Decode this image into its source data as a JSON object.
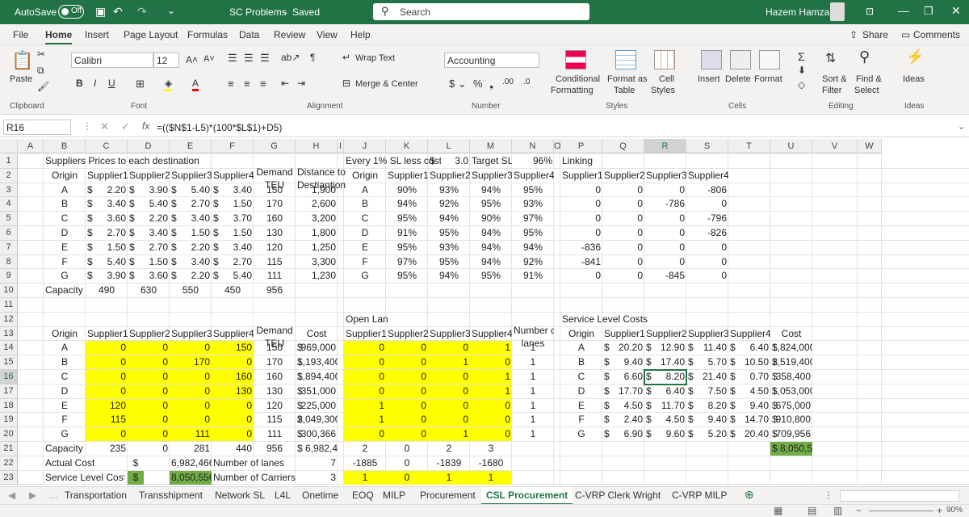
{
  "titlebar": {
    "autosave": "AutoSave",
    "autosave_state": "Off",
    "file_title": "SC Problems",
    "saved_state": "Saved",
    "search_placeholder": "Search",
    "user": "Hazem Hamza"
  },
  "menu": [
    "File",
    "Home",
    "Insert",
    "Page Layout",
    "Formulas",
    "Data",
    "Review",
    "View",
    "Help"
  ],
  "share": "Share",
  "comments": "Comments",
  "ribbon": {
    "font_name": "Calibri",
    "font_size": "12",
    "number_format": "Accounting",
    "wrap_text": "Wrap Text",
    "merge_center": "Merge & Center",
    "paste": "Paste",
    "cond_fmt": "Conditional",
    "cond_fmt2": "Formatting",
    "fmt_table": "Format as",
    "fmt_table2": "Table",
    "cell_styles": "Cell",
    "cell_styles2": "Styles",
    "insert": "Insert",
    "delete": "Delete",
    "format": "Format",
    "sort": "Sort &",
    "sort2": "Filter",
    "find": "Find &",
    "find2": "Select",
    "ideas": "Ideas",
    "groups": [
      "Clipboard",
      "Font",
      "Alignment",
      "Number",
      "Styles",
      "Cells",
      "Editing",
      "Ideas"
    ]
  },
  "formula": {
    "namebox": "R16",
    "fx": "fx",
    "content": "=(($N$1-L5)*(100*$L$1)+D5)"
  },
  "columns": [
    "A",
    "B",
    "C",
    "D",
    "E",
    "F",
    "G",
    "H",
    "I",
    "J",
    "K",
    "L",
    "M",
    "N",
    "O",
    "P",
    "Q",
    "R",
    "S",
    "T",
    "U",
    "V",
    "W"
  ],
  "rows": [
    "1",
    "2",
    "3",
    "4",
    "5",
    "6",
    "7",
    "8",
    "9",
    "10",
    "11",
    "12",
    "13",
    "14",
    "15",
    "16",
    "17",
    "18",
    "19",
    "20",
    "21",
    "22",
    "23"
  ],
  "cells": {
    "r1": {
      "B": "Suppliers Prices to each destination",
      "J": "Every 1% SL less cost",
      "K": "$",
      "L": "3.0",
      "M": "Target SL",
      "N": "96%",
      "P": "Linking"
    },
    "r2": {
      "B": "Origin",
      "C": "Supplier1",
      "D": "Supplier2",
      "E": "Supplier3",
      "F": "Supplier4",
      "G1": "Demand",
      "G": "TEU",
      "H1": "Distance to",
      "H": "Destiantion Z",
      "J": "Origin",
      "K": "Supplier1",
      "L": "Supplier2",
      "M": "Supplier3",
      "N": "Supplier4",
      "P": "Supplier1",
      "Q": "Supplier2",
      "R": "Supplier3",
      "S": "Supplier4"
    },
    "prices": [
      {
        "o": "A",
        "v": [
          "2.20",
          "3.90",
          "5.40",
          "3.40"
        ],
        "d": "150",
        "z": "1,900",
        "sl": [
          "90%",
          "93%",
          "94%",
          "95%"
        ],
        "lk": [
          "0",
          "0",
          "0",
          "-806"
        ]
      },
      {
        "o": "B",
        "v": [
          "3.40",
          "5.40",
          "2.70",
          "1.50"
        ],
        "d": "170",
        "z": "2,600",
        "sl": [
          "94%",
          "92%",
          "95%",
          "93%"
        ],
        "lk": [
          "0",
          "0",
          "-786",
          "0"
        ]
      },
      {
        "o": "C",
        "v": [
          "3.60",
          "2.20",
          "3.40",
          "3.70"
        ],
        "d": "160",
        "z": "3,200",
        "sl": [
          "95%",
          "94%",
          "90%",
          "97%"
        ],
        "lk": [
          "0",
          "0",
          "0",
          "-796"
        ]
      },
      {
        "o": "D",
        "v": [
          "2.70",
          "3.40",
          "1.50",
          "1.50"
        ],
        "d": "130",
        "z": "1,800",
        "sl": [
          "91%",
          "95%",
          "94%",
          "95%"
        ],
        "lk": [
          "0",
          "0",
          "0",
          "-826"
        ]
      },
      {
        "o": "E",
        "v": [
          "1.50",
          "2.70",
          "2.20",
          "3.40"
        ],
        "d": "120",
        "z": "1,250",
        "sl": [
          "95%",
          "93%",
          "94%",
          "94%"
        ],
        "lk": [
          "-836",
          "0",
          "0",
          "0"
        ]
      },
      {
        "o": "F",
        "v": [
          "5.40",
          "1.50",
          "3.40",
          "2.70"
        ],
        "d": "115",
        "z": "3,300",
        "sl": [
          "97%",
          "95%",
          "94%",
          "92%"
        ],
        "lk": [
          "-841",
          "0",
          "0",
          "0"
        ]
      },
      {
        "o": "G",
        "v": [
          "3.90",
          "3.60",
          "2.20",
          "5.40"
        ],
        "d": "111",
        "z": "1,230",
        "sl": [
          "95%",
          "94%",
          "95%",
          "91%"
        ],
        "lk": [
          "0",
          "0",
          "-845",
          "0"
        ]
      }
    ],
    "r10": {
      "B": "Capacity",
      "C": "490",
      "D": "630",
      "E": "550",
      "F": "450",
      "G": "956"
    },
    "r12": {
      "J": "Open Lan",
      "P": "Service Level Costs"
    },
    "r13": {
      "B": "Origin",
      "C": "Supplier1",
      "D": "Supplier2",
      "E": "Supplier3",
      "F": "Supplier4",
      "G1": "Demand",
      "G": "TEU",
      "H": "Cost",
      "J": "Supplier1",
      "K": "Supplier2",
      "L": "Supplier3",
      "M": "Supplier4",
      "N1": "Number of",
      "N": "lanes",
      "P": "Origin",
      "Q": "Supplier1",
      "R": "Supplier2",
      "S": "Supplier3",
      "T": "Supplier4",
      "U": "Cost"
    },
    "alloc": [
      {
        "o": "A",
        "q": [
          "0",
          "0",
          "0",
          "150"
        ],
        "d": "150",
        "cost": "969,000",
        "ol": [
          "0",
          "0",
          "0",
          "1"
        ],
        "n": "1",
        "sc": [
          "20.20",
          "12.90",
          "11.40",
          "6.40"
        ],
        "u": "1,824,000"
      },
      {
        "o": "B",
        "q": [
          "0",
          "0",
          "170",
          "0"
        ],
        "d": "170",
        "cost": "1,193,400",
        "ol": [
          "0",
          "0",
          "1",
          "0"
        ],
        "n": "1",
        "sc": [
          "9.40",
          "17.40",
          "5.70",
          "10.50"
        ],
        "u": "2,519,400"
      },
      {
        "o": "C",
        "q": [
          "0",
          "0",
          "0",
          "160"
        ],
        "d": "160",
        "cost": "1,894,400",
        "ol": [
          "0",
          "0",
          "0",
          "1"
        ],
        "n": "1",
        "sc": [
          "6.60",
          "8.20",
          "21.40",
          "0.70"
        ],
        "u": "358,400"
      },
      {
        "o": "D",
        "q": [
          "0",
          "0",
          "0",
          "130"
        ],
        "d": "130",
        "cost": "351,000",
        "ol": [
          "0",
          "0",
          "0",
          "1"
        ],
        "n": "1",
        "sc": [
          "17.70",
          "6.40",
          "7.50",
          "4.50"
        ],
        "u": "1,053,000"
      },
      {
        "o": "E",
        "q": [
          "120",
          "0",
          "0",
          "0"
        ],
        "d": "120",
        "cost": "225,000",
        "ol": [
          "1",
          "0",
          "0",
          "0"
        ],
        "n": "1",
        "sc": [
          "4.50",
          "11.70",
          "8.20",
          "9.40"
        ],
        "u": "675,000"
      },
      {
        "o": "F",
        "q": [
          "115",
          "0",
          "0",
          "0"
        ],
        "d": "115",
        "cost": "2,049,300",
        "ol": [
          "1",
          "0",
          "0",
          "0"
        ],
        "n": "1",
        "sc": [
          "2.40",
          "4.50",
          "9.40",
          "14.70"
        ],
        "u": "910,800"
      },
      {
        "o": "G",
        "q": [
          "0",
          "0",
          "111",
          "0"
        ],
        "d": "111",
        "cost": "300,366",
        "ol": [
          "0",
          "0",
          "1",
          "0"
        ],
        "n": "1",
        "sc": [
          "6.90",
          "9.60",
          "5.20",
          "20.40"
        ],
        "u": "709,956"
      }
    ],
    "r21": {
      "B": "Capacity",
      "C": "235",
      "D": "0",
      "E": "281",
      "F": "440",
      "G": "956",
      "H": "$ 6,982,466",
      "J": "2",
      "K": "0",
      "L": "2",
      "M": "3",
      "U": "$ 8,050,556"
    },
    "r22": {
      "B": "Actual Cost",
      "C": "$",
      "E": "6,982,466",
      "F": "Number of lanes",
      "H": "7",
      "J": "-1885",
      "K": "0",
      "L": "-1839",
      "M": "-1680"
    },
    "r23": {
      "B": "Service Level Cost",
      "C": "$",
      "E": "8,050,556",
      "F": "Number of Carriers",
      "H": "3",
      "J": "1",
      "K": "0",
      "L": "1",
      "M": "1"
    }
  },
  "sheets": [
    "Transportation",
    "Transshipment",
    "Network SL",
    "L4L",
    "Onetime",
    "EOQ",
    "MILP",
    "Procurement",
    "CSL Procurement",
    "C-VRP Clerk Wright",
    "C-VRP MILP"
  ],
  "active_sheet": "CSL Procurement",
  "zoom": "90%"
}
